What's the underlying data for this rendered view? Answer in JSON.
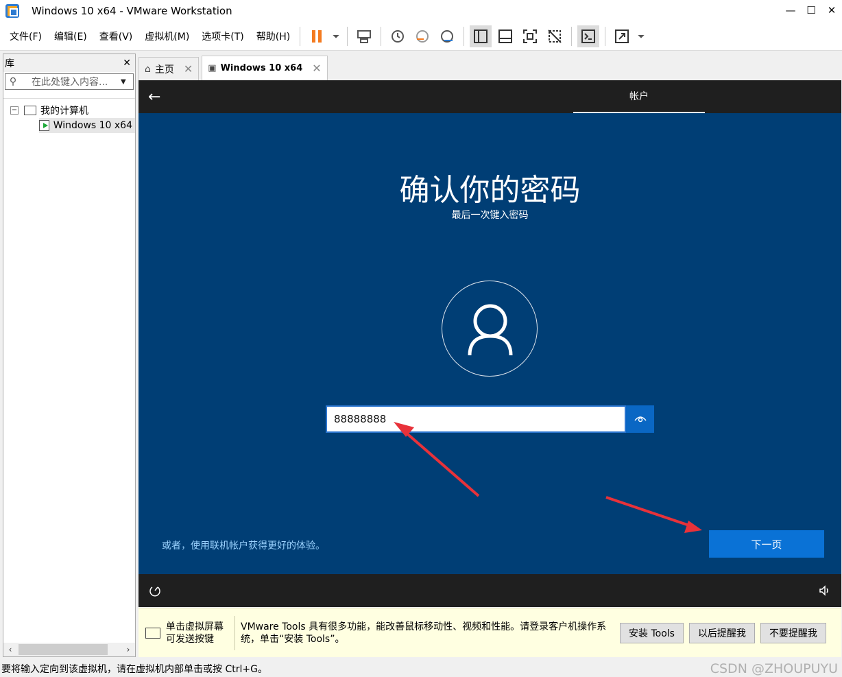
{
  "window": {
    "title": "Windows 10 x64 - VMware Workstation"
  },
  "menu": [
    "文件(F)",
    "编辑(E)",
    "查看(V)",
    "虚拟机(M)",
    "选项卡(T)",
    "帮助(H)"
  ],
  "library": {
    "title": "库",
    "search_placeholder": "在此处键入内容...",
    "tree_root": "我的计算机",
    "tree_vm": "Windows 10 x64"
  },
  "tabs": [
    {
      "label": "主页"
    },
    {
      "label": "Windows 10 x64"
    }
  ],
  "oobe": {
    "section_tab": "帐户",
    "heading": "确认你的密码",
    "subheading": "最后一次键入密码",
    "password_value": "88888888",
    "online_link": "或者，使用联机帐户获得更好的体验。",
    "next_label": "下一页"
  },
  "notification": {
    "click_hint": "单击虚拟屏幕可发送按键",
    "message": "VMware Tools 具有很多功能，能改善鼠标移动性、视频和性能。请登录客户机操作系统，单击“安装 Tools”。",
    "install_label": "安装 Tools",
    "remind_later_label": "以后提醒我",
    "never_remind_label": "不要提醒我"
  },
  "status": {
    "text": "要将输入定向到该虚拟机，请在虚拟机内部单击或按 Ctrl+G。",
    "watermark": "CSDN @ZHOUPUYU"
  },
  "colors": {
    "oobe_bg": "#003e75",
    "next_button": "#0a72d6",
    "arrow": "#e8323a"
  }
}
